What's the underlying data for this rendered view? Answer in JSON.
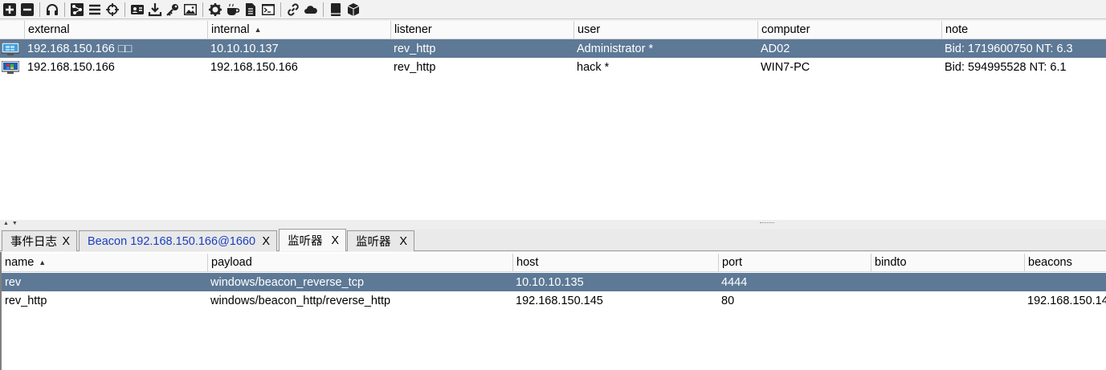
{
  "toolbar": {
    "buttons": [
      {
        "icon": "plus-square-icon"
      },
      {
        "icon": "minus-square-icon"
      },
      {
        "icon": "headphones-icon"
      },
      {
        "icon": "pivot-graph-icon"
      },
      {
        "icon": "session-list-icon"
      },
      {
        "icon": "crosshair-icon"
      },
      {
        "icon": "credentials-icon"
      },
      {
        "icon": "download-icon"
      },
      {
        "icon": "key-icon"
      },
      {
        "icon": "screenshot-image-icon"
      },
      {
        "icon": "gear-icon"
      },
      {
        "icon": "coffee-cup-icon"
      },
      {
        "icon": "document-icon"
      },
      {
        "icon": "console-icon"
      },
      {
        "icon": "link-icon"
      },
      {
        "icon": "cloud-icon"
      },
      {
        "icon": "book-icon"
      },
      {
        "icon": "package-cube-icon"
      }
    ]
  },
  "sessions": {
    "columns": [
      "external",
      "internal",
      "listener",
      "user",
      "computer",
      "note"
    ],
    "sort_column": "internal",
    "sort_direction": "ascending",
    "rows": [
      {
        "icon": "windows-server-icon",
        "external": "192.168.150.166 □□",
        "internal": "10.10.10.137",
        "listener": "rev_http",
        "user": "Administrator *",
        "computer": "AD02",
        "note": "Bid: 1719600750  NT: 6.3",
        "selected": true
      },
      {
        "icon": "windows-7-icon",
        "external": "192.168.150.166",
        "internal": "192.168.150.166",
        "listener": "rev_http",
        "user": "hack *",
        "computer": "WIN7-PC",
        "note": "Bid: 594995528  NT: 6.1",
        "selected": false
      }
    ]
  },
  "tabs": [
    {
      "label": "事件日志",
      "close": "X",
      "active": false
    },
    {
      "label": "Beacon 192.168.150.166@1660",
      "close": "X",
      "active": false
    },
    {
      "label": "监听器",
      "close": "X",
      "active": true
    },
    {
      "label": "监听器",
      "close": "X",
      "active": false
    }
  ],
  "listeners": {
    "columns": [
      "name",
      "payload",
      "host",
      "port",
      "bindto",
      "beacons"
    ],
    "sort_column": "name",
    "sort_direction": "ascending",
    "rows": [
      {
        "name": "rev",
        "payload": "windows/beacon_reverse_tcp",
        "host": "10.10.10.135",
        "port": "4444",
        "bindto": "",
        "beacons": "",
        "selected": true
      },
      {
        "name": "rev_http",
        "payload": "windows/beacon_http/reverse_http",
        "host": "192.168.150.145",
        "port": "80",
        "bindto": "",
        "beacons": "192.168.150.14",
        "selected": false
      }
    ]
  },
  "colors": {
    "selection": "#5d7996",
    "beacon_tab_text": "#1a3fc0"
  }
}
